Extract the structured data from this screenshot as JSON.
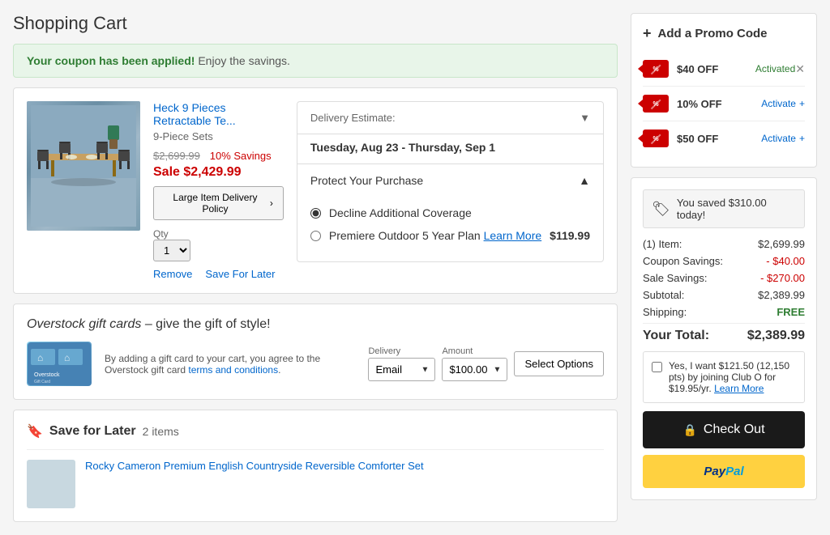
{
  "page": {
    "title": "Shopping Cart"
  },
  "coupon": {
    "banner_applied": "Your coupon has been applied!",
    "banner_enjoy": " Enjoy the savings."
  },
  "item": {
    "title": "Heck 9 Pieces Retractable Te...",
    "subtitle": "9-Piece Sets",
    "original_price": "$2,699.99",
    "savings_label": "10% Savings",
    "sale_label": "Sale",
    "sale_price": "$2,429.99",
    "delivery_policy_btn": "Large Item Delivery Policy",
    "qty_label": "Qty",
    "qty_value": "1",
    "remove_label": "Remove",
    "save_for_later_label": "Save For Later"
  },
  "delivery": {
    "estimate_label": "Delivery Estimate:",
    "date": "Tuesday, Aug 23 - Thursday, Sep 1",
    "protect_title": "Protect Your Purchase",
    "option1": "Decline Additional Coverage",
    "option2": "Premiere Outdoor 5 Year Plan",
    "option2_learn": "Learn More",
    "option2_price": "$119.99"
  },
  "gift_cards": {
    "title": "Overstock gift cards",
    "subtitle": "– give the gift of style!",
    "description": "By adding a gift card to your cart, you agree to the Overstock gift card",
    "terms_link": "terms and conditions",
    "delivery_label": "Delivery",
    "delivery_option": "Email",
    "amount_label": "Amount",
    "amount_option": "$100.00",
    "select_options_btn": "Select Options"
  },
  "save_later": {
    "title": "Save for Later",
    "count": "2 items",
    "item_title": "Rocky Cameron Premium English Countryside Reversible Comforter Set"
  },
  "sidebar": {
    "promo_title": "Add a Promo Code",
    "promos": [
      {
        "label": "$40 OFF",
        "status": "Activated",
        "activated": true
      },
      {
        "label": "10% OFF",
        "status": "Activate",
        "activated": false
      },
      {
        "label": "$50 OFF",
        "status": "Activate",
        "activated": false
      }
    ],
    "savings_today": "You saved $310.00 today!",
    "items_label": "(1) Item:",
    "items_value": "$2,699.99",
    "coupon_savings_label": "Coupon Savings:",
    "coupon_savings_value": "- $40.00",
    "sale_savings_label": "Sale Savings:",
    "sale_savings_value": "- $270.00",
    "subtotal_label": "Subtotal:",
    "subtotal_value": "$2,389.99",
    "shipping_label": "Shipping:",
    "shipping_value": "FREE",
    "total_label": "Your Total:",
    "total_value": "$2,389.99",
    "club_text": "Yes, I want $121.50 (12,150 pts) by joining Club O for $19.95/yr.",
    "club_learn": "Learn More",
    "checkout_btn": "Check Out",
    "paypal_label": "PayPal"
  }
}
